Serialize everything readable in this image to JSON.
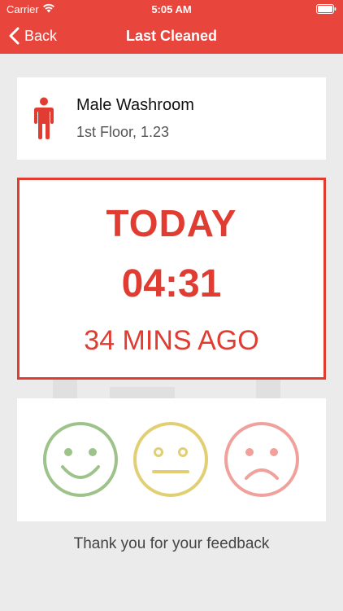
{
  "status_bar": {
    "carrier": "Carrier",
    "time": "5:05 AM"
  },
  "nav": {
    "back_label": "Back",
    "title": "Last Cleaned"
  },
  "location": {
    "name": "Male Washroom",
    "detail": "1st Floor, 1.23",
    "icon": "male-person-icon"
  },
  "last_cleaned": {
    "day": "TODAY",
    "time": "04:31",
    "ago": "34 MINS AGO"
  },
  "feedback": {
    "faces": [
      {
        "name": "happy-face-icon",
        "color": "#9ec38a"
      },
      {
        "name": "neutral-face-icon",
        "color": "#e2cf74"
      },
      {
        "name": "sad-face-icon",
        "color": "#f0a19c"
      }
    ],
    "thanks": "Thank you for your feedback"
  },
  "colors": {
    "accent": "#e8453c",
    "highlight": "#e03c31",
    "background": "#ebebeb"
  }
}
